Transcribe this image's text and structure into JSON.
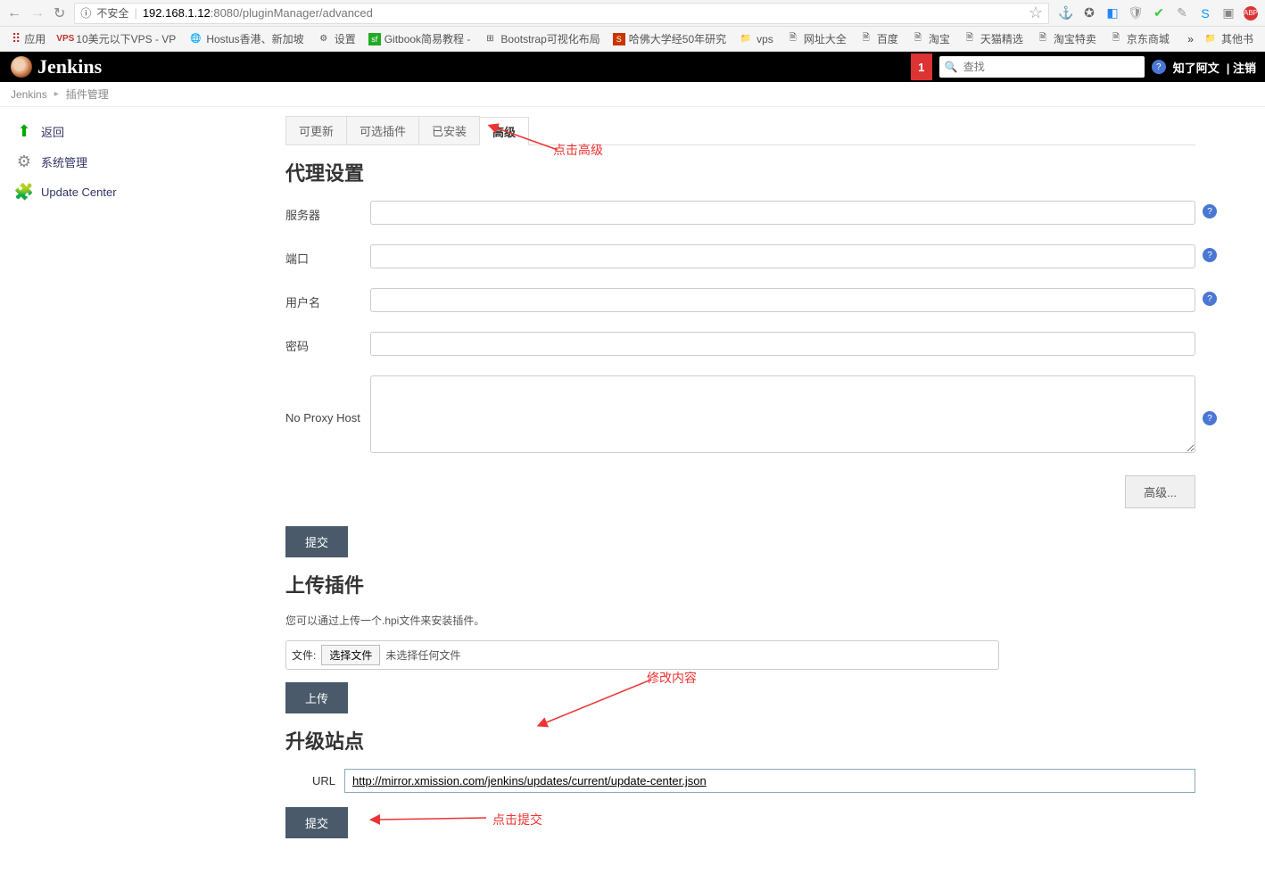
{
  "browser": {
    "insecure_label": "不安全",
    "url_host": "192.168.1.12",
    "url_port": ":8080",
    "url_path": "/pluginManager/advanced"
  },
  "bookmarks": {
    "apps_label": "应用",
    "items": [
      {
        "label": "10美元以下VPS - VP"
      },
      {
        "label": "Hostus香港、新加坡"
      },
      {
        "label": "设置"
      },
      {
        "label": "Gitbook简易教程 - "
      },
      {
        "label": "Bootstrap可视化布局"
      },
      {
        "label": "哈佛大学经50年研究"
      },
      {
        "label": "vps"
      },
      {
        "label": "网址大全"
      },
      {
        "label": "百度"
      },
      {
        "label": "淘宝"
      },
      {
        "label": "天猫精选"
      },
      {
        "label": "淘宝特卖"
      },
      {
        "label": "京东商城"
      }
    ],
    "other_label": "其他书"
  },
  "header": {
    "app_name": "Jenkins",
    "notification_count": "1",
    "search_placeholder": "查找",
    "user_link": "知了阿文",
    "logout": "| 注销"
  },
  "breadcrumb": {
    "home": "Jenkins",
    "current": "插件管理"
  },
  "sidebar": {
    "return": "返回",
    "system_mgmt": "系统管理",
    "update_center": "Update Center"
  },
  "tabs": {
    "updatable": "可更新",
    "available": "可选插件",
    "installed": "已安装",
    "advanced": "高级"
  },
  "proxy": {
    "title": "代理设置",
    "server_label": "服务器",
    "port_label": "端口",
    "username_label": "用户名",
    "password_label": "密码",
    "noproxy_label": "No Proxy Host",
    "advanced_btn": "高级...",
    "submit": "提交"
  },
  "upload": {
    "title": "上传插件",
    "desc": "您可以通过上传一个.hpi文件来安装插件。",
    "file_label": "文件:",
    "choose_btn": "选择文件",
    "no_file": "未选择任何文件",
    "upload_btn": "上传"
  },
  "updatesite": {
    "title": "升级站点",
    "url_label": "URL",
    "url_value": "http://mirror.xmission.com/jenkins/updates/current/update-center.json",
    "submit": "提交"
  },
  "annotations": {
    "click_advanced": "点击高级",
    "modify_content": "修改内容",
    "click_submit": "点击提交"
  }
}
